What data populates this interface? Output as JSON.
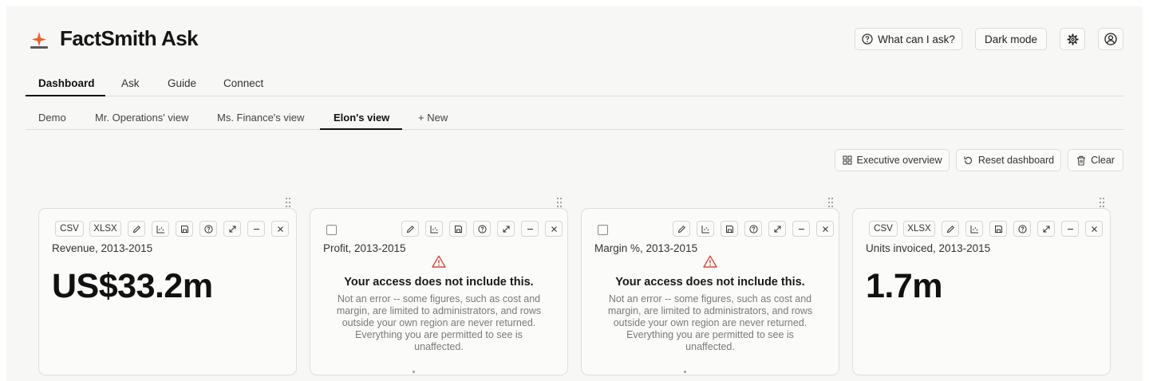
{
  "app": {
    "title": "FactSmith Ask"
  },
  "header": {
    "help_label": "What can I ask?",
    "dark_mode_label": "Dark mode"
  },
  "main_tabs": [
    {
      "label": "Dashboard",
      "active": true
    },
    {
      "label": "Ask",
      "active": false
    },
    {
      "label": "Guide",
      "active": false
    },
    {
      "label": "Connect",
      "active": false
    }
  ],
  "view_tabs": [
    {
      "label": "Demo",
      "active": false
    },
    {
      "label": "Mr. Operations' view",
      "active": false
    },
    {
      "label": "Ms. Finance's view",
      "active": false
    },
    {
      "label": "Elon's view",
      "active": true
    },
    {
      "label": "+ New",
      "active": false
    }
  ],
  "actions": {
    "executive_overview": "Executive overview",
    "reset_dashboard": "Reset dashboard",
    "clear": "Clear"
  },
  "cards": [
    {
      "title": "Revenue, 2013-2015",
      "value": "US$33.2m",
      "csv_label": "CSV",
      "xlsx_label": "XLSX"
    },
    {
      "title": "Profit, 2013-2015",
      "error_title": "Your access does not include this.",
      "error_body": "Not an error -- some figures, such as cost and margin, are limited to administrators, and rows outside your own region are never returned. Everything you are permitted to see is unaffected."
    },
    {
      "title": "Margin %, 2013-2015",
      "error_title": "Your access does not include this.",
      "error_body": "Not an error -- some figures, such as cost and margin, are limited to administrators, and rows outside your own region are never returned. Everything you are permitted to see is unaffected."
    },
    {
      "title": "Units invoiced, 2013-2015",
      "value": "1.7m",
      "csv_label": "CSV",
      "xlsx_label": "XLSX"
    }
  ],
  "colors": {
    "accent": "#e8612c",
    "warning": "#d04a3c",
    "text": "#1c1c1c",
    "border": "#dcdcd8",
    "background": "#f7f7f5"
  },
  "icons": [
    "sparkle-logo-icon",
    "help-circle-icon",
    "gear-icon",
    "user-circle-icon",
    "grid-icon",
    "reset-icon",
    "trash-icon",
    "drag-handle-icon",
    "pencil-icon",
    "chart-icon",
    "save-icon",
    "question-icon",
    "expand-icon",
    "minimize-icon",
    "close-icon",
    "warning-icon"
  ]
}
